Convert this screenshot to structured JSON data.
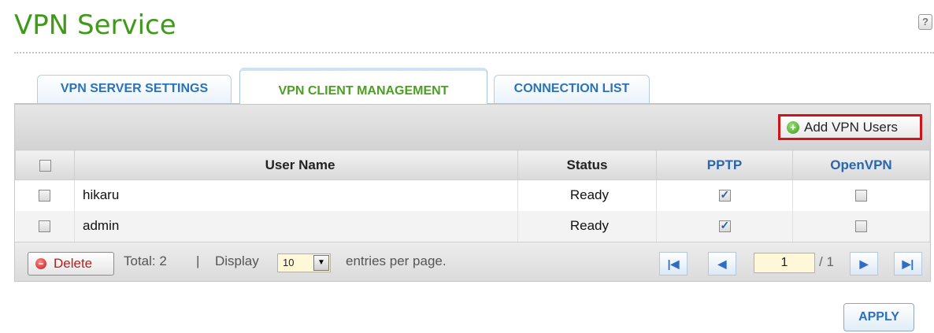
{
  "page": {
    "title": "VPN Service",
    "help_icon": "?"
  },
  "tabs": [
    {
      "label": "VPN SERVER SETTINGS",
      "active": false
    },
    {
      "label": "VPN CLIENT MANAGEMENT",
      "active": true
    },
    {
      "label": "CONNECTION LIST",
      "active": false
    }
  ],
  "toolbar": {
    "add_label": "Add VPN Users",
    "add_icon": "plus-circle-icon"
  },
  "table": {
    "headers": {
      "name": "User Name",
      "status": "Status",
      "pptp": "PPTP",
      "openvpn": "OpenVPN"
    },
    "rows": [
      {
        "name": "hikaru",
        "status": "Ready",
        "pptp": true,
        "openvpn": false
      },
      {
        "name": "admin",
        "status": "Ready",
        "pptp": true,
        "openvpn": false
      }
    ]
  },
  "footer": {
    "delete_label": "Delete",
    "total": "Total:  2",
    "separator": "|",
    "display_label": "Display",
    "display_value": "10",
    "per_page": "entries per page.",
    "page_value": "1",
    "page_of": "/ 1"
  },
  "apply_label": "APPLY",
  "colors": {
    "title": "#3f9a1a",
    "tab_text": "#2a73b8",
    "active_tab": "#4aa020",
    "highlight": "#d0141a"
  }
}
